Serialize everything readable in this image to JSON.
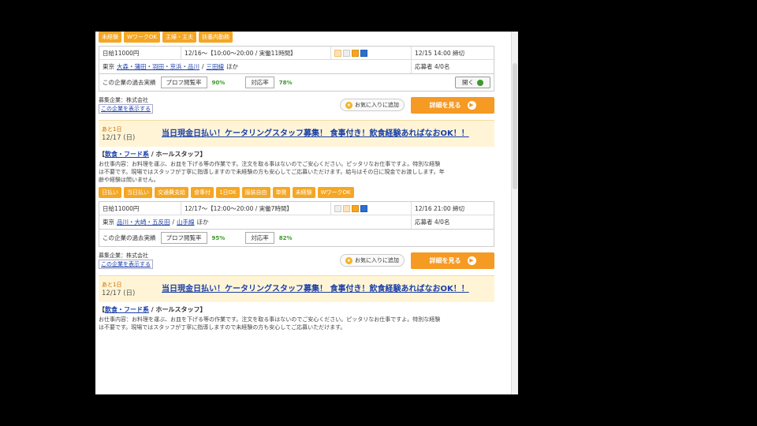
{
  "listing1": {
    "tags": [
      "未経験",
      "WワークOK",
      "主婦・主夫",
      "扶養内勤務"
    ],
    "pay": "日給11000円",
    "schedule": "12/16～【10:00～20:00 / 実働11時間】",
    "deadline": "12/15 14:00 締切",
    "access_prefix": "東京",
    "access_link1": "大森・蒲田・羽田・京浜・品川",
    "access_link2": "三田線",
    "access_suffix": "ほか",
    "applicants_label": "応募者 4/0名",
    "stats_label": "この企業の過去実績",
    "box1": "プロフ閲覧率",
    "pct1": "90%",
    "box2": "対応率",
    "pct2": "78%",
    "toggle": "開く",
    "company_label": "募集企業：株式会社",
    "company_link": "この企業を表示する",
    "fav": "お気に入りに追加",
    "detail": "詳細を見る"
  },
  "listing2": {
    "date_line1": "あと1日",
    "date_line2": "12/17 (日)",
    "title": "当日現金日払い！ケータリングスタッフ募集！ 食事付き！飲食経験あればなおOK！！",
    "category_link": "飲食・フード系",
    "category_rest": " / ホールスタッフ】",
    "desc": "お仕事内容：お料理を運ぶ、お皿を下げる等の作業です。注文を取る事はないのでご安心ください。ピッタリなお仕事ですよ。特別な経験は不要です。現場ではスタッフが丁寧に指導しますので未経験の方も安心してご応募いただけます。給与はその日に現金でお渡しします。年齢や経験は問いません。",
    "tags": [
      "日払い",
      "当日払い",
      "交通費支給",
      "食事付",
      "1日OK",
      "服装自由",
      "単発",
      "未経験",
      "WワークOK"
    ],
    "pay": "日給11000円",
    "schedule": "12/17～【12:00～20:00 / 実働7時間】",
    "deadline": "12/16 21:00 締切",
    "access_prefix": "東京",
    "access_link1": "品川・大崎・五反田",
    "access_link2": "山手線",
    "access_suffix": "ほか",
    "applicants_label": "応募者 4/0名",
    "stats_label": "この企業の過去実績",
    "box1": "プロフ閲覧率",
    "pct1": "95%",
    "box2": "対応率",
    "pct2": "82%",
    "company_label": "募集企業：株式会社",
    "company_link": "この企業を表示する",
    "fav": "お気に入りに追加",
    "detail": "詳細を見る"
  },
  "listing3": {
    "date_line1": "あと1日",
    "date_line2": "12/17 (日)",
    "title": "当日現金日払い！ケータリングスタッフ募集！ 食事付き！飲食経験あればなおOK！！",
    "category_link": "飲食・フード系",
    "category_rest": " / ホールスタッフ】",
    "desc": "お仕事内容：お料理を運ぶ、お皿を下げる等の作業です。注文を取る事はないのでご安心ください。ピッタリなお仕事ですよ。特別な経験は不要です。現場ではスタッフが丁寧に指導しますので未経験の方も安心してご応募いただけます。"
  },
  "colors": {
    "accent": "#f5a623",
    "link": "#1a3fa8",
    "header_bg": "#fff5d6"
  },
  "icons": [
    "star-icon",
    "arrow-right-icon",
    "status-dot-icon"
  ]
}
